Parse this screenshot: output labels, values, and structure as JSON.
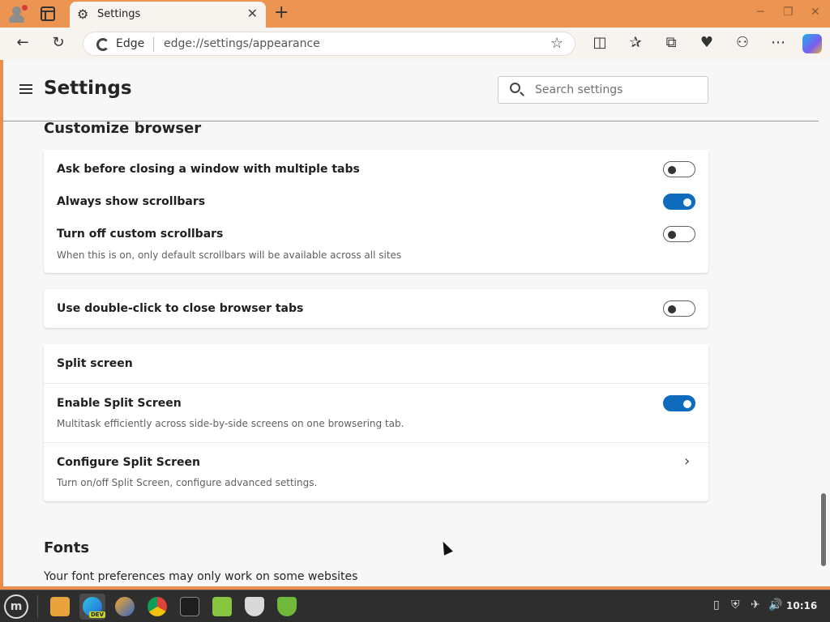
{
  "browser": {
    "tab_title": "Settings",
    "omnibox_brand": "Edge",
    "url": "edge://settings/appearance"
  },
  "settings": {
    "title": "Settings",
    "search_placeholder": "Search settings"
  },
  "customize": {
    "title": "Customize browser",
    "rows": [
      {
        "label": "Ask before closing a window with multiple tabs",
        "on": false
      },
      {
        "label": "Always show scrollbars",
        "on": true
      },
      {
        "label": "Turn off custom scrollbars",
        "desc": "When this is on, only default scrollbars will be available across all sites",
        "on": false
      }
    ],
    "double_click": {
      "label": "Use double-click to close browser tabs",
      "on": false
    }
  },
  "split_screen": {
    "title": "Split screen",
    "enable": {
      "label": "Enable Split Screen",
      "desc": "Multitask efficiently across side-by-side screens on one browsering tab.",
      "on": true
    },
    "configure": {
      "label": "Configure Split Screen",
      "desc": "Turn on/off Split Screen, configure advanced settings."
    }
  },
  "fonts": {
    "title": "Fonts",
    "desc": "Your font preferences may only work on some websites"
  },
  "taskbar": {
    "dev_badge": "DEV",
    "clock": "10:16"
  },
  "colors": {
    "title_bar": "#ec9552",
    "accent": "#0f6cbd",
    "taskbar": "#2e2e2e"
  }
}
